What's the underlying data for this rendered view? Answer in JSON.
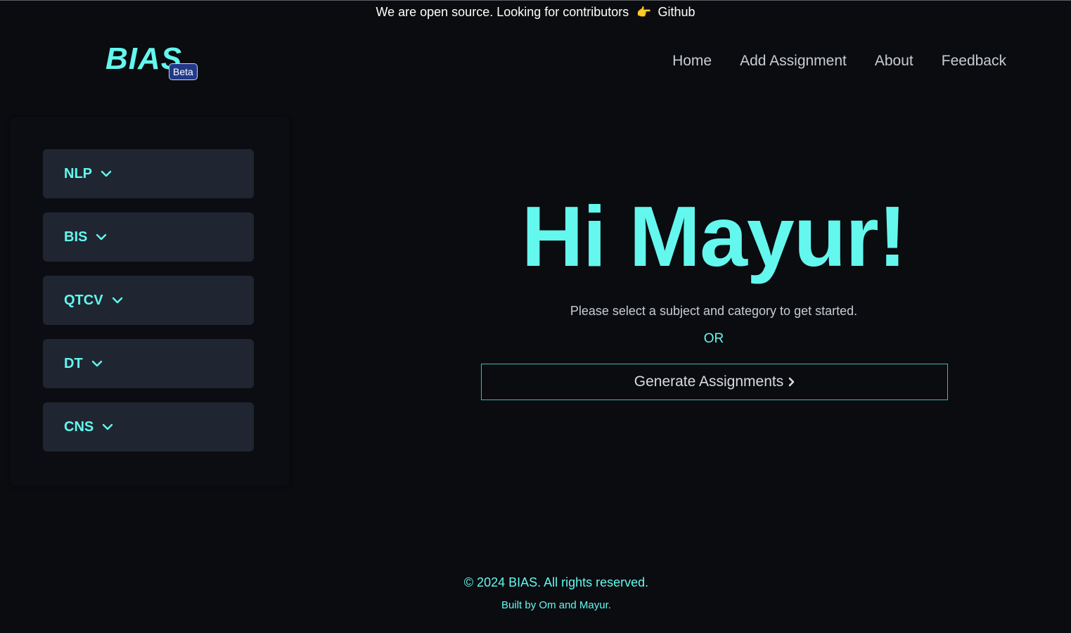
{
  "banner": {
    "text": "We are open source. Looking for contributors",
    "emoji": "👉",
    "link_label": "Github"
  },
  "header": {
    "logo_text": "BIAS",
    "badge": "Beta",
    "nav": [
      {
        "label": "Home"
      },
      {
        "label": "Add Assignment"
      },
      {
        "label": "About"
      },
      {
        "label": "Feedback"
      }
    ]
  },
  "sidebar": {
    "subjects": [
      {
        "label": "NLP",
        "icon": "chevron-down-icon"
      },
      {
        "label": "BIS",
        "icon": "chevron-down-icon"
      },
      {
        "label": "QTCV",
        "icon": "chevron-down-icon"
      },
      {
        "label": "DT",
        "icon": "chevron-down-icon"
      },
      {
        "label": "CNS",
        "icon": "chevron-down-icon"
      }
    ]
  },
  "main": {
    "greeting": "Hi Mayur!",
    "subtitle": "Please select a subject and category to get started.",
    "or": "OR",
    "generate_label": "Generate Assignments",
    "generate_icon": "chevron-right-icon"
  },
  "footer": {
    "copyright": "© 2024 BIAS. All rights reserved.",
    "built_by": "Built by Om and Mayur."
  },
  "colors": {
    "background": "#0a0c10",
    "accent": "#64f7ee",
    "card": "#1f2631",
    "badge": "#22398a"
  }
}
